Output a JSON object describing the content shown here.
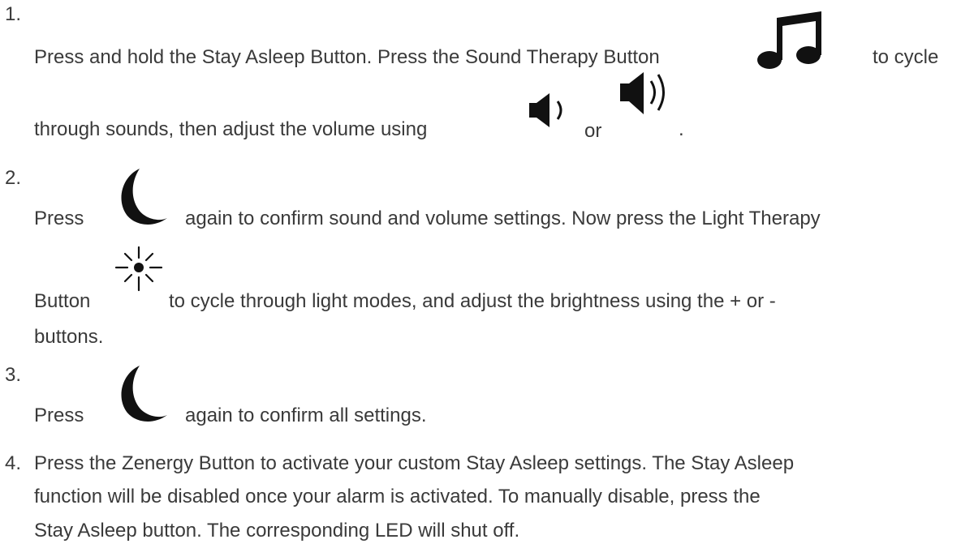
{
  "steps": [
    {
      "number": "1.",
      "line1_a": "Press and hold the Stay Asleep Button. Press the Sound Therapy Button",
      "line1_b": "to cycle",
      "line2_a": "through sounds, then adjust the volume using",
      "line2_or": "or",
      "line2_end": "."
    },
    {
      "number": "2.",
      "line1_a": "Press",
      "line1_b": "again to confirm sound and volume settings. Now press the Light Therapy",
      "line2_a": "Button",
      "line2_b": "to cycle through light modes, and adjust the brightness using the + or -",
      "line3": "buttons."
    },
    {
      "number": "3.",
      "line1_a": "Press",
      "line1_b": "again to confirm all settings."
    },
    {
      "number": "4.",
      "line1": "Press the Zenergy Button to activate your custom Stay Asleep settings. The Stay Asleep",
      "line2": "function will be disabled once your alarm is activated. To manually disable, press the",
      "line3": "Stay Asleep button. The corresponding LED will shut off."
    }
  ],
  "icons": {
    "sound_therapy": "music-note-icon",
    "volume_down": "volume-low-icon",
    "volume_up": "volume-high-icon",
    "stay_asleep": "crescent-moon-icon",
    "light_therapy": "sun-icon"
  }
}
